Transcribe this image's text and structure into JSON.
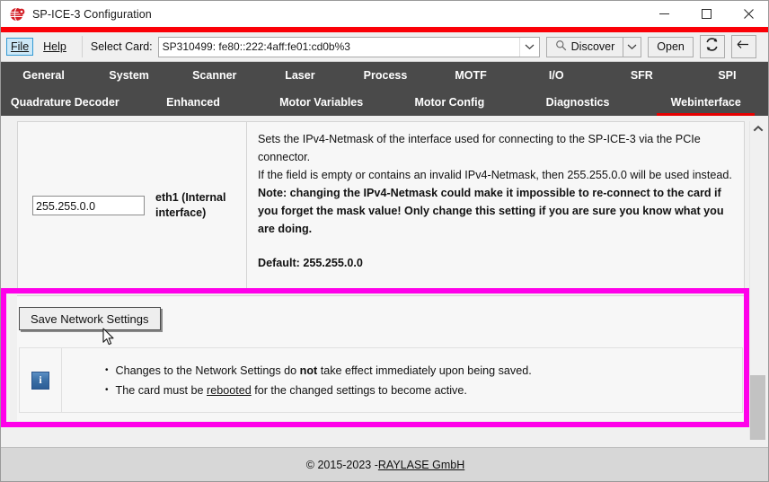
{
  "window": {
    "title": "SP-ICE-3 Configuration",
    "app_icon": "raylase-logo-icon",
    "minimize_label": "minimize-icon",
    "maximize_label": "maximize-icon",
    "close_label": "close-icon",
    "accent_red": "#fb0007",
    "annotation_magenta": "#ff00ea"
  },
  "toolbar": {
    "file_menu": "File",
    "help_menu": "Help",
    "select_card_label": "Select Card:",
    "card_value": "SP310499: fe80::222:4aff:fe01:cd0b%3",
    "discover_label": "Discover",
    "open_label": "Open",
    "refresh_icon": "refresh-icon",
    "back_icon": "back-arrow-icon"
  },
  "tabs": {
    "row1": [
      {
        "label": "General",
        "active": false
      },
      {
        "label": "System",
        "active": false
      },
      {
        "label": "Scanner",
        "active": false
      },
      {
        "label": "Laser",
        "active": false
      },
      {
        "label": "Process",
        "active": false
      },
      {
        "label": "MOTF",
        "active": false
      },
      {
        "label": "I/O",
        "active": false
      },
      {
        "label": "SFR",
        "active": false
      },
      {
        "label": "SPI",
        "active": false
      }
    ],
    "row2": [
      {
        "label": "Quadrature Decoder",
        "active": false
      },
      {
        "label": "Enhanced",
        "active": false
      },
      {
        "label": "Motor Variables",
        "active": false
      },
      {
        "label": "Motor Config",
        "active": false
      },
      {
        "label": "Diagnostics",
        "active": false
      },
      {
        "label": "Webinterface",
        "active": true
      }
    ]
  },
  "setting": {
    "netmask_value": "255.255.0.0",
    "netmask_placeholder": "",
    "interface_label": "eth1 (Internal interface)",
    "desc_line1": "Sets the IPv4-Netmask of the interface used for connecting to the SP-ICE-3 via the PCIe connector.",
    "desc_line2": "If the field is empty or contains an invalid IPv4-Netmask, then 255.255.0.0 will be used instead.",
    "desc_note": "Note: changing the IPv4-Netmask could make it impossible to re-connect to the card if you forget the mask value! Only change this setting if you are sure you know what you are doing.",
    "desc_default": "Default: 255.255.0.0"
  },
  "actions": {
    "save_label": "Save Network Settings"
  },
  "info": {
    "icon": "info-icon",
    "bullet1_pre": "Changes to the Network Settings do ",
    "bullet1_bold": "not",
    "bullet1_post": " take effect immediately upon being saved.",
    "bullet2_pre": "The card must be ",
    "bullet2_underline": "rebooted",
    "bullet2_post": " for the changed settings to become active.",
    "bullet_marker": "•"
  },
  "scrollbar": {
    "up_arrow": "chevron-up-icon"
  },
  "footer": {
    "copyright": "© 2015-2023 - ",
    "company": "RAYLASE GmbH"
  }
}
